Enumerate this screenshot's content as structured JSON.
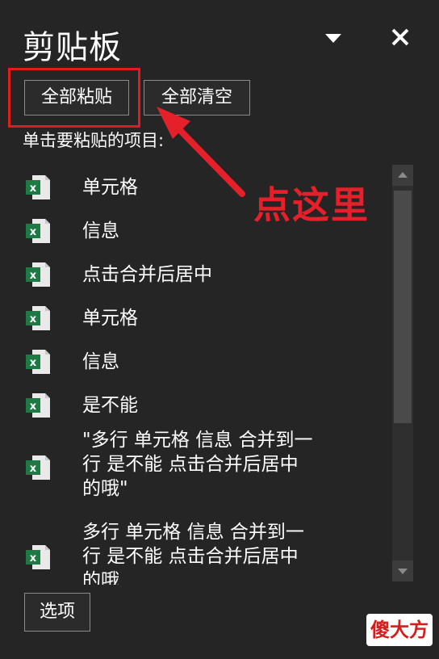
{
  "panel": {
    "title": "剪贴板",
    "paste_all_label": "全部粘贴",
    "clear_all_label": "全部清空",
    "instruction": "单击要粘贴的项目:",
    "options_label": "选项"
  },
  "items": [
    {
      "label": "单元格",
      "icon": "excel-icon"
    },
    {
      "label": "信息",
      "icon": "excel-icon"
    },
    {
      "label": "点击合并后居中",
      "icon": "excel-icon"
    },
    {
      "label": "单元格",
      "icon": "excel-icon"
    },
    {
      "label": "信息",
      "icon": "excel-icon"
    },
    {
      "label": "是不能",
      "icon": "excel-icon"
    },
    {
      "label": "\"多行 单元格 信息 合并到一\n行 是不能 点击合并后居中\n的哦\"",
      "icon": "excel-icon"
    },
    {
      "label": "多行 单元格 信息 合并到一\n行 是不能 点击合并后居中\n的哦",
      "icon": "excel-icon"
    }
  ],
  "annotation": {
    "text": "点这里",
    "color": "#e5202a"
  },
  "watermark": {
    "text": "傻大方"
  },
  "colors": {
    "background": "#252525",
    "excel_green": "#1d7a45",
    "highlight_red": "#e41b1b"
  }
}
